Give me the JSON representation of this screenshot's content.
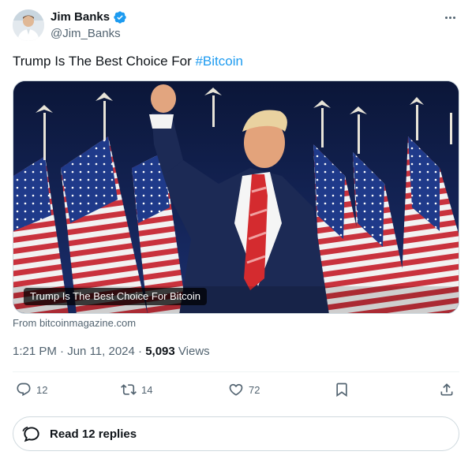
{
  "author": {
    "display_name": "Jim Banks",
    "handle": "@Jim_Banks",
    "verified": true
  },
  "tweet": {
    "text_prefix": "Trump Is The Best Choice For ",
    "hashtag": "#Bitcoin"
  },
  "media": {
    "caption": "Trump Is The Best Choice For Bitcoin",
    "source": "From bitcoinmagazine.com"
  },
  "meta": {
    "time": "1:21 PM",
    "separator": "·",
    "date": "Jun 11, 2024",
    "views_count": "5,093",
    "views_label": "Views"
  },
  "actions": {
    "replies": "12",
    "reposts": "14",
    "likes": "72"
  },
  "read_replies": {
    "label": "Read 12 replies"
  },
  "colors": {
    "accent": "#1d9bf0",
    "text_primary": "#0f1419",
    "text_secondary": "#536471",
    "border": "#cfd9de"
  },
  "icons": {
    "verified": "verified-badge-icon",
    "more": "more-icon",
    "reply": "reply-icon",
    "repost": "repost-icon",
    "like": "heart-icon",
    "bookmark": "bookmark-icon",
    "share": "share-icon",
    "replies_bubble": "chat-bubble-icon"
  }
}
